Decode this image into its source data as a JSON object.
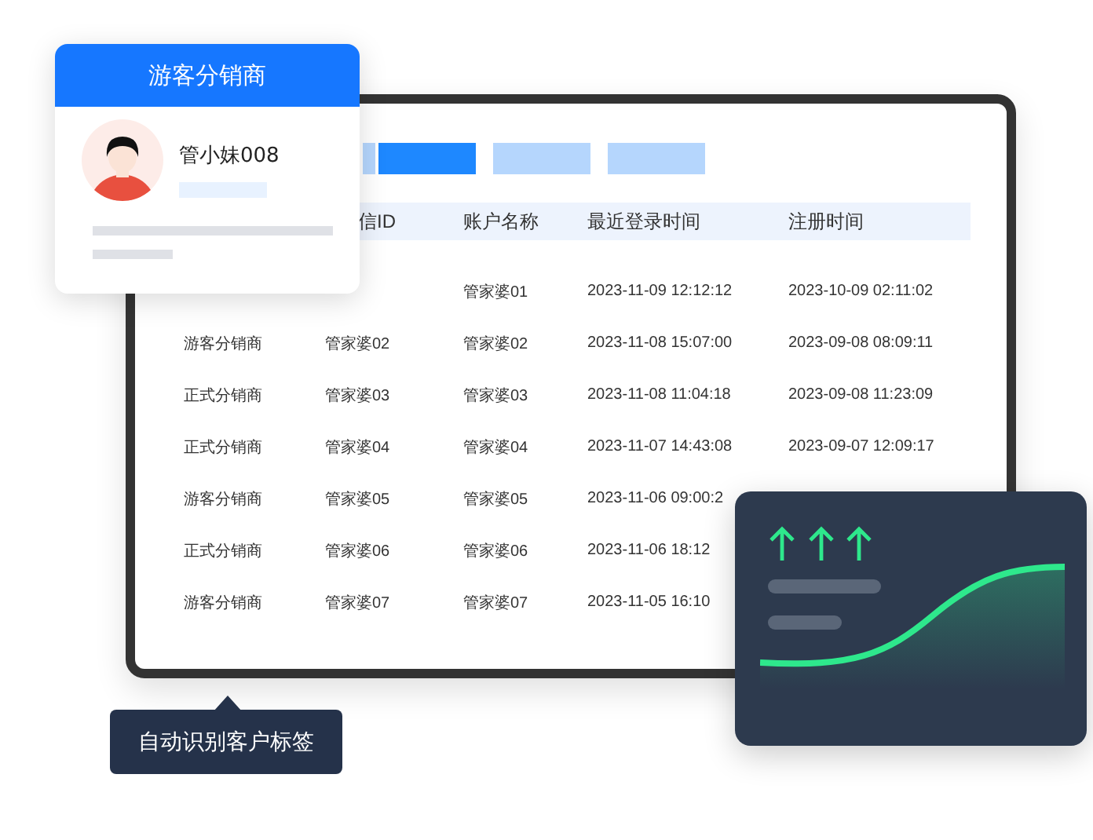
{
  "profile_card": {
    "title": "游客分销商",
    "name": "管小妹008"
  },
  "toolbar": {
    "tabs": [
      {
        "selected": false
      },
      {
        "selected": true
      },
      {
        "selected": false
      },
      {
        "selected": false
      }
    ]
  },
  "table": {
    "columns": [
      null,
      "信ID",
      "账户名称",
      "最近登录时间",
      "注册时间"
    ],
    "rows": [
      [
        null,
        null,
        "管家婆01",
        "2023-11-09 12:12:12",
        "2023-10-09 02:11:02"
      ],
      [
        "游客分销商",
        "管家婆02",
        "管家婆02",
        "2023-11-08 15:07:00",
        "2023-09-08 08:09:11"
      ],
      [
        "正式分销商",
        "管家婆03",
        "管家婆03",
        "2023-11-08 11:04:18",
        "2023-09-08 11:23:09"
      ],
      [
        "正式分销商",
        "管家婆04",
        "管家婆04",
        "2023-11-07 14:43:08",
        "2023-09-07 12:09:17"
      ],
      [
        "游客分销商",
        "管家婆05",
        "管家婆05",
        "2023-11-06 09:00:2",
        null
      ],
      [
        "正式分销商",
        "管家婆06",
        "管家婆06",
        "2023-11-06 18:12",
        null
      ],
      [
        "游客分销商",
        "管家婆07",
        "管家婆07",
        "2023-11-05 16:10",
        null
      ]
    ]
  },
  "tooltip": {
    "text": "自动识别客户标签"
  }
}
